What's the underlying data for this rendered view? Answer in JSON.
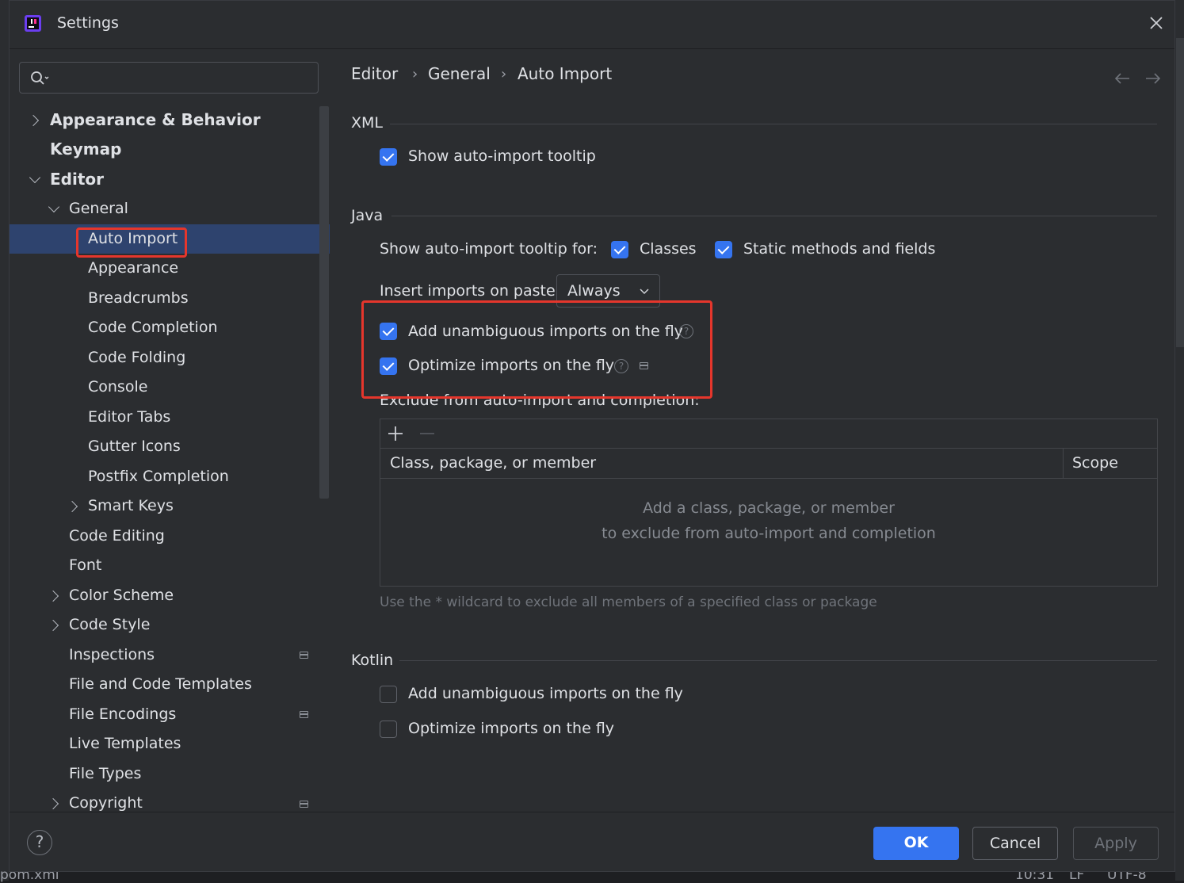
{
  "window": {
    "title": "Settings"
  },
  "search": {
    "placeholder": ""
  },
  "sidebar": {
    "items": [
      {
        "label": "Appearance & Behavior"
      },
      {
        "label": "Keymap"
      },
      {
        "label": "Editor"
      },
      {
        "label": "General"
      },
      {
        "label": "Auto Import"
      },
      {
        "label": "Appearance"
      },
      {
        "label": "Breadcrumbs"
      },
      {
        "label": "Code Completion"
      },
      {
        "label": "Code Folding"
      },
      {
        "label": "Console"
      },
      {
        "label": "Editor Tabs"
      },
      {
        "label": "Gutter Icons"
      },
      {
        "label": "Postfix Completion"
      },
      {
        "label": "Smart Keys"
      },
      {
        "label": "Code Editing"
      },
      {
        "label": "Font"
      },
      {
        "label": "Color Scheme"
      },
      {
        "label": "Code Style"
      },
      {
        "label": "Inspections"
      },
      {
        "label": "File and Code Templates"
      },
      {
        "label": "File Encodings"
      },
      {
        "label": "Live Templates"
      },
      {
        "label": "File Types"
      },
      {
        "label": "Copyright"
      }
    ],
    "selected": "Auto Import"
  },
  "breadcrumb": {
    "items": [
      "Editor",
      "General",
      "Auto Import"
    ],
    "separator": "›"
  },
  "xml": {
    "heading": "XML",
    "show_tooltip": {
      "label": "Show auto-import tooltip",
      "checked": true
    }
  },
  "java": {
    "heading": "Java",
    "tooltip_for_label": "Show auto-import tooltip for:",
    "classes": {
      "label": "Classes",
      "checked": true
    },
    "static_members": {
      "label": "Static methods and fields",
      "checked": true
    },
    "insert_on_paste_label": "Insert imports on paste:",
    "insert_on_paste_value": "Always",
    "add_unambiguous": {
      "label": "Add unambiguous imports on the fly",
      "checked": true
    },
    "optimize": {
      "label": "Optimize imports on the fly",
      "checked": true
    },
    "exclude_label": "Exclude from auto-import and completion:",
    "table": {
      "columns": [
        "Class, package, or member",
        "Scope"
      ],
      "empty_line1": "Add a class, package, or member",
      "empty_line2": "to exclude from auto-import and completion"
    },
    "hint": "Use the * wildcard to exclude all members of a specified class or package"
  },
  "kotlin": {
    "heading": "Kotlin",
    "add_unambiguous": {
      "label": "Add unambiguous imports on the fly",
      "checked": false
    },
    "optimize": {
      "label": "Optimize imports on the fly",
      "checked": false
    }
  },
  "buttons": {
    "ok": "OK",
    "cancel": "Cancel",
    "apply": "Apply"
  },
  "background": {
    "status_file": "pom.xml",
    "status_time": "10:31",
    "status_lf": "LF",
    "status_enc": "UTF-8"
  },
  "colors": {
    "accent": "#3574f0",
    "highlight_box": "#e5362c",
    "selection": "#2e436e"
  }
}
